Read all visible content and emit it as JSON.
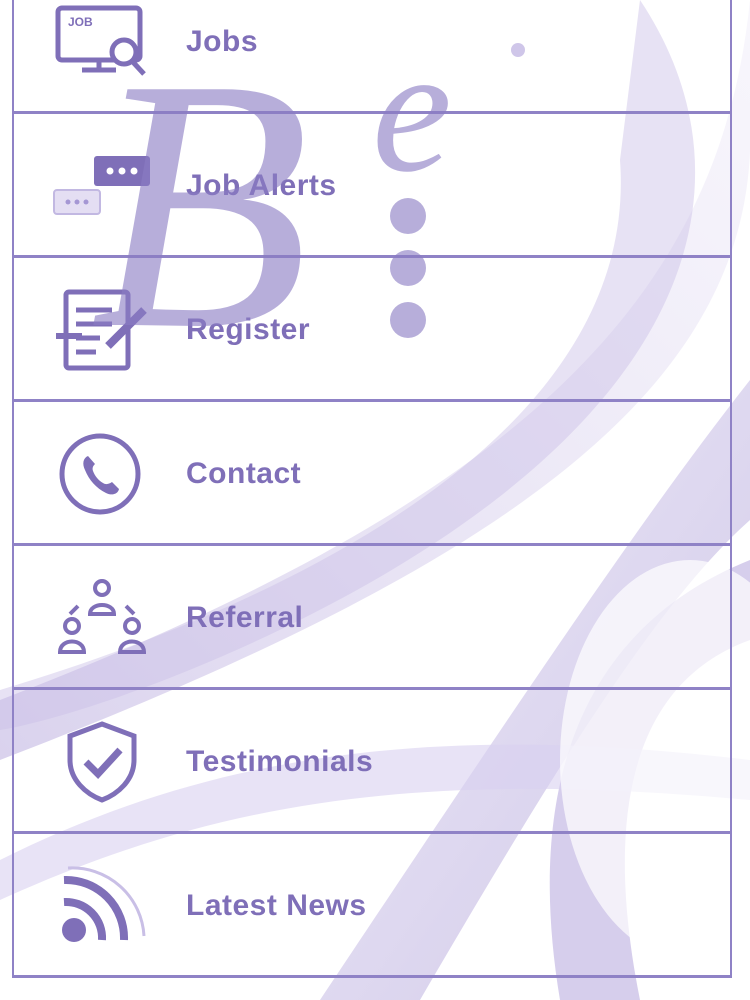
{
  "brand": {
    "logo_letter": "B",
    "logo_superscript": "e",
    "accent": "#7f6fb8",
    "line": "#8f82c6"
  },
  "menu": {
    "items": [
      {
        "label": "Jobs",
        "icon": "job-search-icon"
      },
      {
        "label": "Job Alerts",
        "icon": "chat-alert-icon"
      },
      {
        "label": "Register",
        "icon": "register-form-icon"
      },
      {
        "label": "Contact",
        "icon": "phone-icon"
      },
      {
        "label": "Referral",
        "icon": "referral-people-icon"
      },
      {
        "label": "Testimonials",
        "icon": "shield-check-icon"
      },
      {
        "label": "Latest News",
        "icon": "rss-feed-icon"
      }
    ]
  }
}
